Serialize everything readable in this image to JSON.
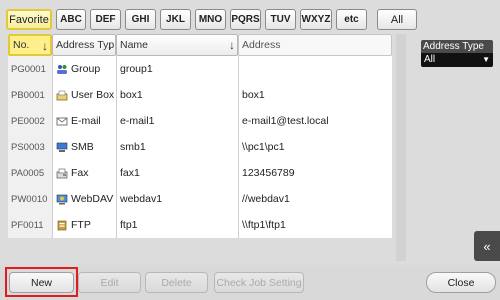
{
  "tabs": [
    {
      "label": "Favorite",
      "active": true
    },
    {
      "label": "ABC"
    },
    {
      "label": "DEF"
    },
    {
      "label": "GHI"
    },
    {
      "label": "JKL"
    },
    {
      "label": "MNO"
    },
    {
      "label": "PQRS"
    },
    {
      "label": "TUV"
    },
    {
      "label": "WXYZ"
    },
    {
      "label": "etc"
    },
    {
      "label": "All"
    }
  ],
  "table": {
    "headers": {
      "no": "No.",
      "type": "Address Typ",
      "name": "Name",
      "address": "Address"
    },
    "rows": [
      {
        "no": "PG0001",
        "icon": "group-icon",
        "type": "Group",
        "name": "group1",
        "address": ""
      },
      {
        "no": "PB0001",
        "icon": "user-box-icon",
        "type": "User Box",
        "name": "box1",
        "address": "box1"
      },
      {
        "no": "PE0002",
        "icon": "email-icon",
        "type": "E-mail",
        "name": "e-mail1",
        "address": "e-mail1@test.local"
      },
      {
        "no": "PS0003",
        "icon": "smb-icon",
        "type": "SMB",
        "name": "smb1",
        "address": "\\\\pc1\\pc1"
      },
      {
        "no": "PA0005",
        "icon": "fax-icon",
        "type": "Fax",
        "name": "fax1",
        "address": "123456789"
      },
      {
        "no": "PW0010",
        "icon": "webdav-icon",
        "type": "WebDAV",
        "name": "webdav1",
        "address": "//webdav1"
      },
      {
        "no": "PF0011",
        "icon": "ftp-icon",
        "type": "FTP",
        "name": "ftp1",
        "address": "\\\\ftp1\\ftp1"
      }
    ]
  },
  "filter": {
    "label": "Address Type",
    "value": "All"
  },
  "footer": {
    "new": "New",
    "edit": "Edit",
    "delete": "Delete",
    "check_job": "Check Job Setting",
    "close": "Close"
  },
  "colors": {
    "highlight": "#e01c1c",
    "selected": "#e5c83a"
  }
}
